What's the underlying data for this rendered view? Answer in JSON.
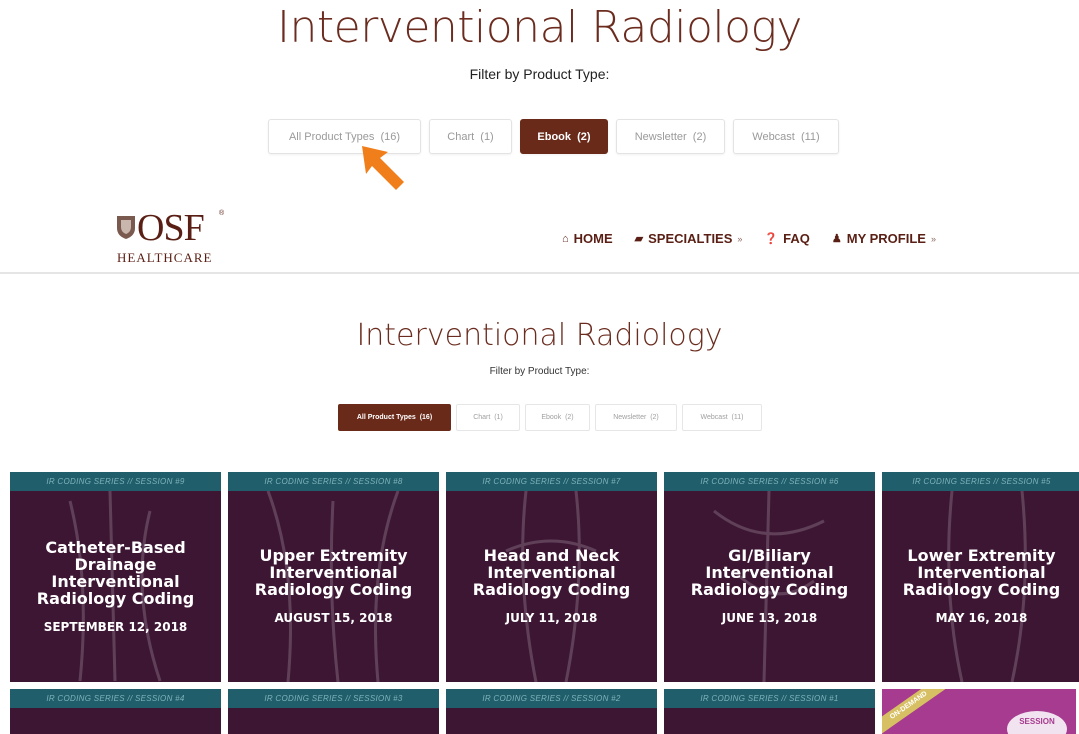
{
  "top": {
    "title": "Interventional Radiology",
    "filter_label": "Filter by Product Type:",
    "filters": [
      {
        "label": "All Product Types  (16)",
        "active": false
      },
      {
        "label": "Chart  (1)",
        "active": false
      },
      {
        "label": "Ebook  (2)",
        "active": true
      },
      {
        "label": "Newsletter  (2)",
        "active": false
      },
      {
        "label": "Webcast  (11)",
        "active": false
      }
    ]
  },
  "annotation": {
    "arrow_color": "#f07e1a"
  },
  "header": {
    "logo_text": "OSF",
    "logo_reg": "®",
    "logo_sub": "HEALTHCARE",
    "nav": [
      {
        "icon": "home-icon",
        "glyph": "⌂",
        "label": "HOME",
        "has_dropdown": false
      },
      {
        "icon": "book-icon",
        "glyph": "▰",
        "label": "SPECIALTIES",
        "has_dropdown": true
      },
      {
        "icon": "question-icon",
        "glyph": "❓",
        "label": "FAQ",
        "has_dropdown": false
      },
      {
        "icon": "user-icon",
        "glyph": "♟",
        "label": "MY PROFILE",
        "has_dropdown": true
      }
    ],
    "chevron": "»"
  },
  "main": {
    "title": "Interventional Radiology",
    "filter_label": "Filter by Product Type:",
    "filters": [
      {
        "label": "All Product Types  (16)",
        "active": true
      },
      {
        "label": "Chart  (1)",
        "active": false
      },
      {
        "label": "Ebook  (2)",
        "active": false
      },
      {
        "label": "Newsletter  (2)",
        "active": false
      },
      {
        "label": "Webcast  (11)",
        "active": false
      }
    ]
  },
  "cards": [
    {
      "band": "IR CODING SERIES // SESSION #9",
      "title": "Catheter-Based Drainage Interventional Radiology Coding",
      "date": "SEPTEMBER 12, 2018"
    },
    {
      "band": "IR CODING SERIES // SESSION #8",
      "title": "Upper Extremity Interventional Radiology Coding",
      "date": "AUGUST 15, 2018"
    },
    {
      "band": "IR CODING SERIES // SESSION #7",
      "title": "Head and Neck Interventional Radiology Coding",
      "date": "JULY 11, 2018"
    },
    {
      "band": "IR CODING SERIES // SESSION #6",
      "title": "GI/Biliary Interventional Radiology Coding",
      "date": "JUNE 13, 2018"
    },
    {
      "band": "IR CODING SERIES // SESSION #5",
      "title": "Lower Extremity Interventional Radiology Coding",
      "date": "MAY 16, 2018"
    }
  ],
  "cards_row2": [
    {
      "band": "IR CODING SERIES // SESSION #4"
    },
    {
      "band": "IR CODING SERIES // SESSION #3"
    },
    {
      "band": "IR CODING SERIES // SESSION #2"
    },
    {
      "band": "IR CODING SERIES // SESSION #1"
    }
  ],
  "ondemand_card": {
    "ribbon": "ON-DEMAND",
    "badge": "SESSION"
  },
  "colors": {
    "brand": "#6a2a19",
    "card_bg": "#3d1634",
    "card_band": "#1f5e6a",
    "pink_card": "#a63b8f"
  }
}
